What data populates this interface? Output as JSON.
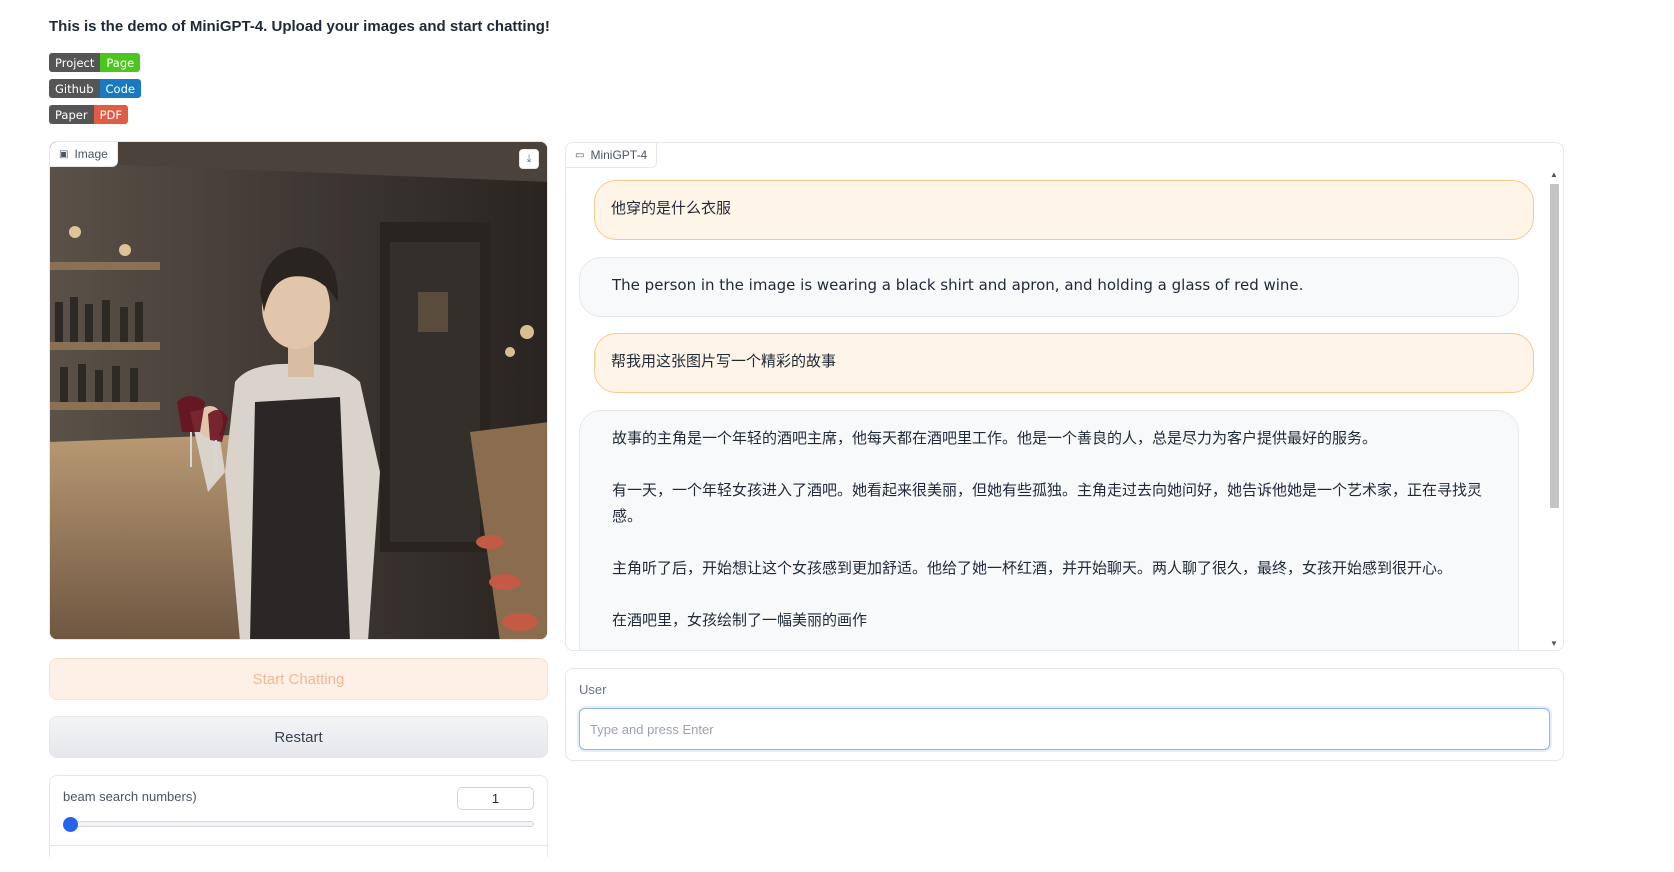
{
  "intro": "This is the demo of MiniGPT-4. Upload your images and start chatting!",
  "badges": [
    {
      "left": "Project",
      "right": "Page"
    },
    {
      "left": "Github",
      "right": "Code"
    },
    {
      "left": "Paper",
      "right": "PDF"
    }
  ],
  "image_panel": {
    "label": "Image"
  },
  "buttons": {
    "start": "Start Chatting",
    "restart": "Restart"
  },
  "slider": {
    "label": "beam search numbers)",
    "value": "1"
  },
  "chat": {
    "label": "MiniGPT-4",
    "messages": [
      {
        "role": "user",
        "text": "他穿的是什么衣服"
      },
      {
        "role": "bot",
        "text": "The person in the image is wearing a black shirt and apron, and holding a glass of red wine."
      },
      {
        "role": "user",
        "text": "帮我用这张图片写一个精彩的故事"
      },
      {
        "role": "bot",
        "paragraphs": [
          "故事的主角是一个年轻的酒吧主席，他每天都在酒吧里工作。他是一个善良的人，总是尽力为客户提供最好的服务。",
          "有一天，一个年轻女孩进入了酒吧。她看起来很美丽，但她有些孤独。主角走过去向她问好，她告诉他她是一个艺术家，正在寻找灵感。",
          "主角听了后，开始想让这个女孩感到更加舒适。他给了她一杯红酒，并开始聊天。两人聊了很久，最终，女孩开始感到很开心。",
          "在酒吧里，女孩绘制了一幅美丽的画作"
        ]
      }
    ]
  },
  "user_input": {
    "label": "User",
    "placeholder": "Type and press Enter",
    "value": ""
  }
}
